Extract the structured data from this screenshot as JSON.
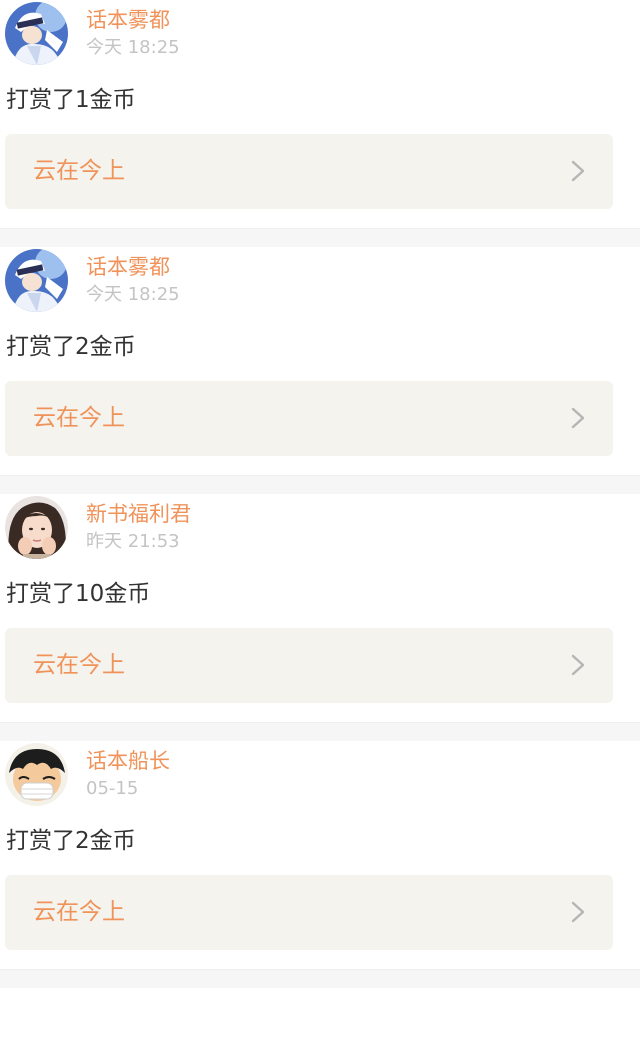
{
  "items": [
    {
      "username": "话本雾都",
      "timestamp": "今天 18:25",
      "reward": "打赏了1金币",
      "book": "云在今上",
      "avatar_icon": "anime-character-avatar-icon"
    },
    {
      "username": "话本雾都",
      "timestamp": "今天 18:25",
      "reward": "打赏了2金币",
      "book": "云在今上",
      "avatar_icon": "anime-character-avatar-icon"
    },
    {
      "username": "新书福利君",
      "timestamp": "昨天 21:53",
      "reward": "打赏了10金币",
      "book": "云在今上",
      "avatar_icon": "girl-photo-avatar-icon"
    },
    {
      "username": "话本船长",
      "timestamp": "05-15",
      "reward": "打赏了2金币",
      "book": "云在今上",
      "avatar_icon": "cartoon-pirate-avatar-icon"
    }
  ],
  "colors": {
    "username": "#f0935a",
    "book_title": "#f0935a",
    "timestamp": "#c4c4c4",
    "reward_text": "#333333",
    "book_link_bg": "#f4f3ee",
    "separator": "#f6f6f6"
  }
}
